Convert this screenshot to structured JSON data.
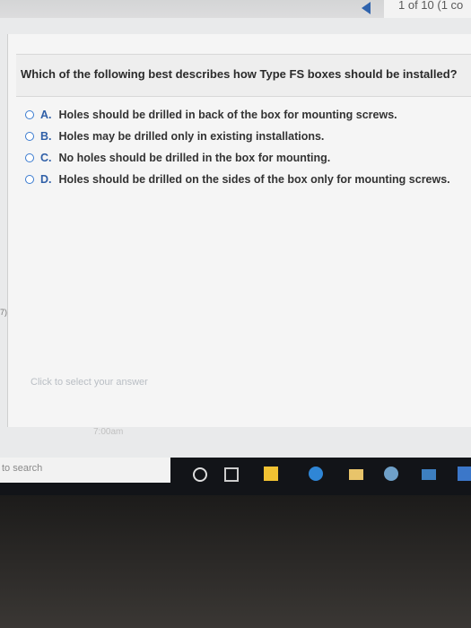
{
  "header": {
    "counter": "1 of 10 (1 co"
  },
  "question": {
    "text": "Which of the following best describes how Type FS boxes should be installed?",
    "options": [
      {
        "letter": "A.",
        "text": "Holes should be drilled in back of the box for mounting screws."
      },
      {
        "letter": "B.",
        "text": "Holes may be drilled only in existing installations."
      },
      {
        "letter": "C.",
        "text": "No holes should be drilled in the box for mounting."
      },
      {
        "letter": "D.",
        "text": "Holes should be drilled on the sides of the box only for mounting screws."
      }
    ]
  },
  "hint": "Click to select your answer",
  "time": "7:00am",
  "side_mark": "7)",
  "taskbar": {
    "search_placeholder": "to search"
  },
  "colors": {
    "accent": "#2f63ad",
    "radio": "#3a7bd0"
  },
  "icons": [
    "prev-arrow-icon",
    "cortana-icon",
    "task-view-icon",
    "store-icon",
    "edge-icon",
    "file-explorer-icon",
    "chrome-icon",
    "mail-icon"
  ]
}
